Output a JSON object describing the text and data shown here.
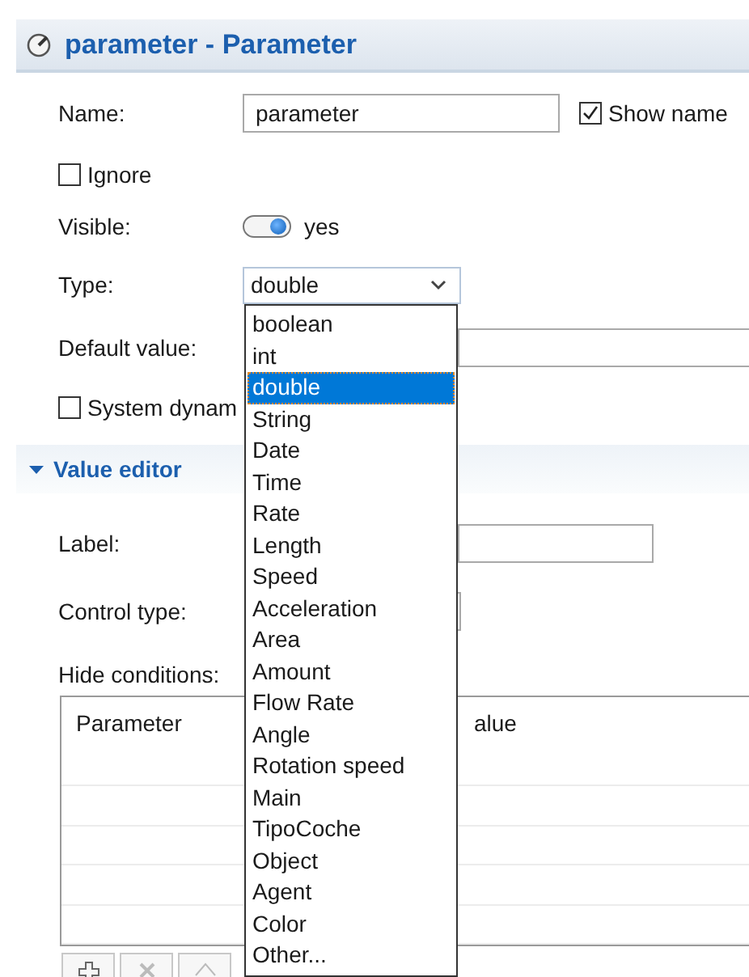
{
  "title": "parameter - Parameter",
  "name": {
    "label": "Name:",
    "value": "parameter"
  },
  "show_name": {
    "label": "Show name",
    "checked": true
  },
  "ignore": {
    "label": "Ignore",
    "checked": false
  },
  "visible": {
    "label": "Visible:",
    "on": true,
    "value_text": "yes"
  },
  "type": {
    "label": "Type:",
    "value": "double",
    "open": true,
    "options": [
      {
        "label": "boolean",
        "selected": false
      },
      {
        "label": "int",
        "selected": false
      },
      {
        "label": "double",
        "selected": true
      },
      {
        "label": "String",
        "selected": false
      },
      {
        "label": "Date",
        "selected": false
      },
      {
        "label": "Time",
        "selected": false
      },
      {
        "label": "Rate",
        "selected": false
      },
      {
        "label": "Length",
        "selected": false
      },
      {
        "label": "Speed",
        "selected": false
      },
      {
        "label": "Acceleration",
        "selected": false
      },
      {
        "label": "Area",
        "selected": false
      },
      {
        "label": "Amount",
        "selected": false
      },
      {
        "label": "Flow Rate",
        "selected": false
      },
      {
        "label": "Angle",
        "selected": false
      },
      {
        "label": "Rotation speed",
        "selected": false
      },
      {
        "label": "Main",
        "selected": false
      },
      {
        "label": "TipoCoche",
        "selected": false
      },
      {
        "label": "Object",
        "selected": false
      },
      {
        "label": "Agent",
        "selected": false
      },
      {
        "label": "Color",
        "selected": false
      },
      {
        "label": "Other...",
        "selected": false
      }
    ]
  },
  "default_value": {
    "label": "Default value:"
  },
  "system_dynamics": {
    "label": "System dynam",
    "checked": false
  },
  "value_editor": {
    "title": "Value editor",
    "expanded": true,
    "label_field": {
      "label": "Label:"
    },
    "control_type": {
      "label": "Control type:"
    },
    "hide_conditions": {
      "label": "Hide conditions:",
      "columns": [
        "Parameter",
        "alue"
      ]
    }
  }
}
